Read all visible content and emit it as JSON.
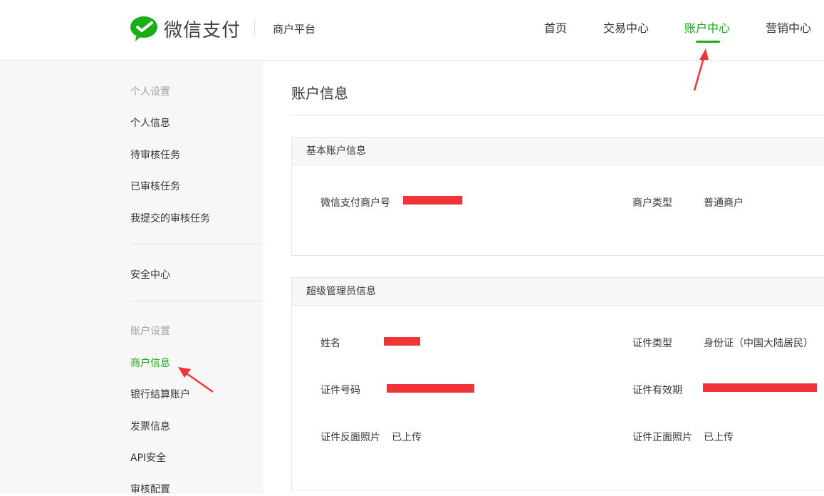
{
  "header": {
    "logo_text": "微信支付",
    "platform": "商户平台",
    "nav": [
      {
        "label": "首页",
        "active": false
      },
      {
        "label": "交易中心",
        "active": false
      },
      {
        "label": "账户中心",
        "active": true
      },
      {
        "label": "营销中心",
        "active": false
      }
    ]
  },
  "sidebar": {
    "groups": [
      {
        "title": "个人设置",
        "items": [
          "个人信息",
          "待审核任务",
          "已审核任务",
          "我提交的审核任务"
        ]
      },
      {
        "title": "",
        "items": [
          "安全中心"
        ]
      },
      {
        "title": "账户设置",
        "items": [
          "商户信息",
          "银行结算账户",
          "发票信息",
          "API安全",
          "审核配置"
        ]
      }
    ],
    "active_item": "商户信息"
  },
  "main": {
    "title": "账户信息",
    "basic_panel": {
      "title": "基本账户信息",
      "merchant_id_label": "微信支付商户号",
      "merchant_type_label": "商户类型",
      "merchant_type_value": "普通商户"
    },
    "admin_panel": {
      "title": "超级管理员信息",
      "name_label": "姓名",
      "id_type_label": "证件类型",
      "id_type_value": "身份证（中国大陆居民）",
      "id_number_label": "证件号码",
      "id_validity_label": "证件有效期",
      "id_back_label": "证件反面照片",
      "id_back_value": "已上传",
      "id_front_label": "证件正面照片",
      "id_front_value": "已上传"
    }
  },
  "colors": {
    "accent": "#1aad19",
    "redaction": "#f1343a",
    "annotation_arrow": "#f1343a"
  }
}
